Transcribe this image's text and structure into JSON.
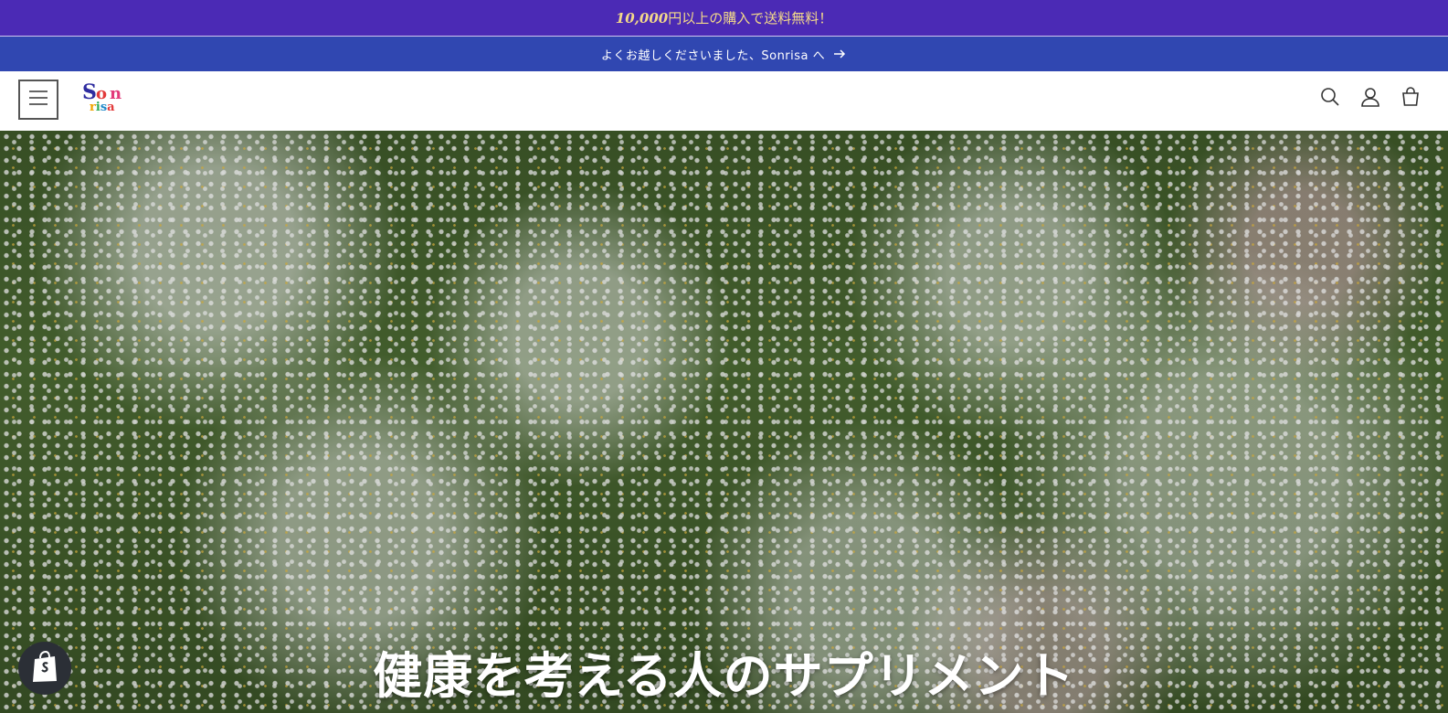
{
  "promo": {
    "amount": "10,000",
    "text": "円以上の購入で送料無料！"
  },
  "announcement": {
    "text": "よくお越しくださいました、Sonrisa へ"
  },
  "header": {
    "logo": {
      "top": [
        "S",
        "o",
        "n"
      ],
      "bottom": [
        "r",
        "i",
        "s",
        "a"
      ]
    },
    "icons": [
      "menu-icon",
      "search-icon",
      "account-icon",
      "cart-icon"
    ]
  },
  "hero": {
    "heading": "健康を考える人のサプリメント"
  },
  "colors": {
    "promo_bg": "#4b2ab5",
    "promo_text": "#f3d98a",
    "announce_bg": "#3047b1"
  }
}
